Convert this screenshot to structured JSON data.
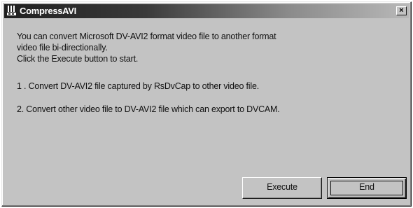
{
  "window": {
    "title": "CompressAVI",
    "icon": "application-icon",
    "close_glyph": "×"
  },
  "content": {
    "description_lines": [
      "You can convert Microsoft DV-AVI2 format video file to another format",
      "video file bi-directionally.",
      "Click the Execute button to start."
    ],
    "items": [
      "1 . Convert DV-AVI2 file captured by RsDvCap to other video file.",
      "2. Convert other video file to DV-AVI2 file which can export to DVCAM."
    ]
  },
  "buttons": {
    "execute_label": "Execute",
    "end_label": "End"
  },
  "colors": {
    "face": "#c3c3c3",
    "titlebar_start": "#1f1f1f",
    "titlebar_end": "#b8b8b8"
  }
}
